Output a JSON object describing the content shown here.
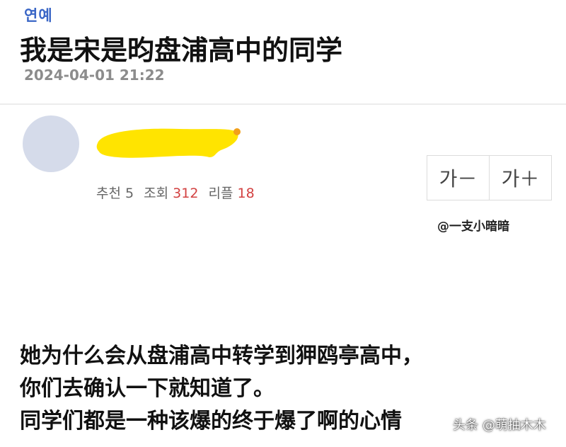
{
  "post": {
    "category": "연예",
    "title": "我是宋是昀盘浦高中的同学",
    "date": "2024-04-01 21:22"
  },
  "author": {
    "avatar_color": "#d5dbea",
    "name_redacted": true,
    "redaction_color": "#ffe400"
  },
  "stats": {
    "recommend_label": "추천",
    "recommend_value": "5",
    "views_label": "조회",
    "views_value": "312",
    "replies_label": "리플",
    "replies_value": "18"
  },
  "font_controls": {
    "decrease_label": "가－",
    "increase_label": "가＋"
  },
  "watermark": "@一支小暗暗",
  "body": {
    "lines": [
      "她为什么会从盘浦高中转学到狎鸥亭高中，",
      "你们去确认一下就知道了。",
      "同学们都是一种该爆的终于爆了啊的心情"
    ]
  },
  "source_watermark": "头条 @萌抽木木",
  "colors": {
    "category": "#3a66c6",
    "highlight_number": "#d24141",
    "date": "#8c8c8c"
  }
}
